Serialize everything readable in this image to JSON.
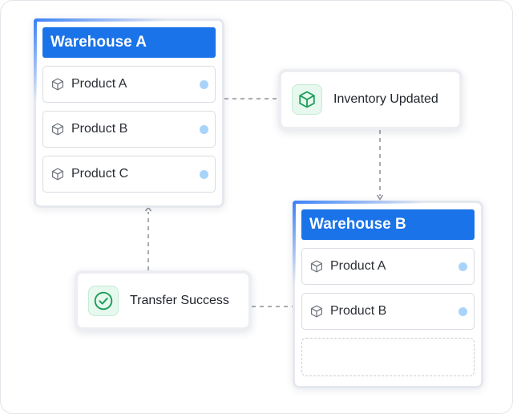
{
  "warehouse_a": {
    "title": "Warehouse A",
    "items": [
      {
        "label": "Product A"
      },
      {
        "label": "Product B"
      },
      {
        "label": "Product C"
      }
    ]
  },
  "warehouse_b": {
    "title": "Warehouse B",
    "items": [
      {
        "label": "Product A"
      },
      {
        "label": "Product B"
      }
    ]
  },
  "events": {
    "inventory": {
      "label": "Inventory Updated",
      "icon": "package-icon"
    },
    "transfer": {
      "label": "Transfer Success",
      "icon": "check-circle-icon"
    }
  },
  "colors": {
    "header": "#1a73e8",
    "status_dot": "#a8d4fb",
    "success_bg": "#e7f8ee",
    "success_icon": "#1e9e5a",
    "connector": "#8a8f98"
  }
}
